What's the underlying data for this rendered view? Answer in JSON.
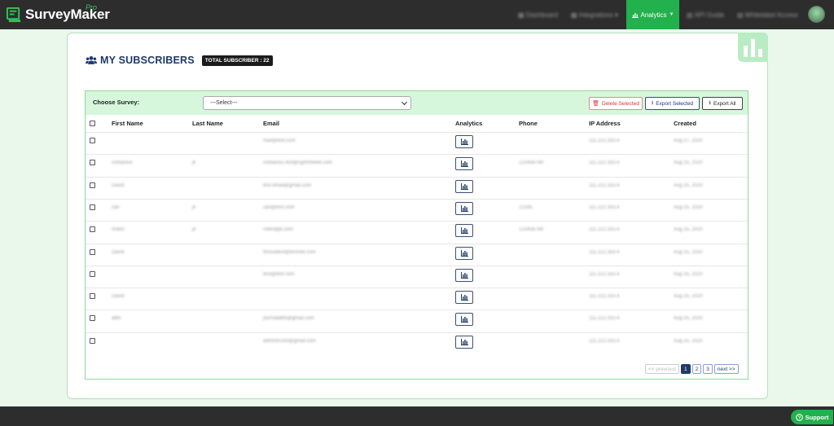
{
  "app": {
    "name": "SurveyMaker",
    "edition": "Pro"
  },
  "nav": {
    "items": [
      {
        "label": "Dashboard"
      },
      {
        "label": "Integrations"
      },
      {
        "label": "Analytics",
        "active": true
      },
      {
        "label": "API Guide"
      },
      {
        "label": "Whitelabel Access"
      }
    ]
  },
  "page": {
    "title": "MY SUBSCRIBERS",
    "total_badge": "TOTAL SUBSCRIBER : 22"
  },
  "toolbar": {
    "choose_label": "Choose Survey:",
    "select_value": "---Select---",
    "delete_label": "Delete Selected",
    "export_selected_label": "Export Selected",
    "export_all_label": "Export All"
  },
  "table": {
    "headers": [
      "First Name",
      "Last Name",
      "Email",
      "Analytics",
      "Phone",
      "IP Address",
      "Created"
    ],
    "rows": [
      {
        "first": "",
        "last": "",
        "email": "mail@test.com",
        "phone": "",
        "ip": "111.222.333.4",
        "created": "Aug 27, 2020"
      },
      {
        "first": "contactus",
        "last": "jk",
        "email": "contactus.test@sgmmlweb.com",
        "phone": "123456789",
        "ip": "111.222.333.4",
        "created": "Aug 25, 2020"
      },
      {
        "first": "David",
        "last": "",
        "email": "test.email@gmail.com",
        "phone": "",
        "ip": "111.222.333.4",
        "created": "Aug 25, 2020"
      },
      {
        "first": "can",
        "last": "jk",
        "email": "can@test.com",
        "phone": "12345",
        "ip": "111.222.333.4",
        "created": "Aug 25, 2020"
      },
      {
        "first": "Robin",
        "last": "jk",
        "email": "robin@jk.com",
        "phone": "123456789",
        "ip": "111.222.333.4",
        "created": "Aug 25, 2020"
      },
      {
        "first": "David",
        "last": "",
        "email": "thisisatest@testsite.com",
        "phone": "",
        "ip": "111.222.333.4",
        "created": "Aug 25, 2020"
      },
      {
        "first": "",
        "last": "",
        "email": "test@test.com",
        "phone": "",
        "ip": "111.222.333.4",
        "created": "Aug 25, 2020"
      },
      {
        "first": "David",
        "last": "",
        "email": "",
        "phone": "",
        "ip": "111.222.333.4",
        "created": "Aug 25, 2020"
      },
      {
        "first": "abhi",
        "last": "",
        "email": "journalabhi@gmail.com",
        "phone": "",
        "ip": "111.222.333.4",
        "created": "Aug 25, 2020"
      },
      {
        "first": "",
        "last": "",
        "email": "abhimm193@gmail.com",
        "phone": "",
        "ip": "111.222.333.4",
        "created": "Aug 25, 2020"
      }
    ]
  },
  "pagination": {
    "previous": "<< previous",
    "pages": [
      "1",
      "2",
      "3"
    ],
    "active_page": "1",
    "next": "next >>"
  },
  "support_label": "Support",
  "colors": {
    "brand_green": "#22b14c",
    "navy": "#1e3a6b",
    "topbar": "#2d2d2d"
  }
}
